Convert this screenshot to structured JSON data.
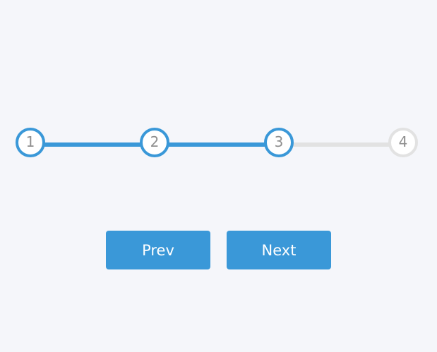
{
  "stepper": {
    "steps": [
      {
        "label": "1"
      },
      {
        "label": "2"
      },
      {
        "label": "3"
      },
      {
        "label": "4"
      }
    ]
  },
  "controls": {
    "prev_label": "Prev",
    "next_label": "Next"
  },
  "colors": {
    "background": "#f5f6fa",
    "active": "#3a98d8",
    "inactive": "#e2e2e2",
    "step_text": "#8f8f8f",
    "button_text": "#ffffff"
  }
}
